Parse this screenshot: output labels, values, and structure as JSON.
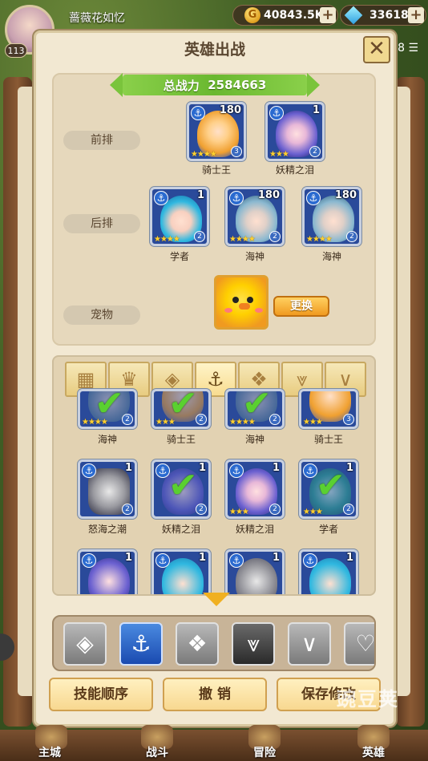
{
  "player": {
    "name": "蔷薇花如忆",
    "level": "113"
  },
  "resources": {
    "gold": "40843.5K",
    "gems": "33618",
    "gold_icon": "gold-coin-icon",
    "gem_icon": "diamond-icon"
  },
  "side_menu": {
    "text": "08"
  },
  "dialog": {
    "title": "英雄出战",
    "close_label": "✕",
    "power_label": "总战力",
    "power_value": "2584663",
    "rows": {
      "front": "前排",
      "back": "后排",
      "pet": "宠物"
    },
    "front": [
      {
        "name": "骑士王",
        "level": "180",
        "badge": "3",
        "stars": "★★★★"
      },
      {
        "name": "妖精之泪",
        "level": "1",
        "badge": "2",
        "stars": "★★★"
      }
    ],
    "back": [
      {
        "name": "学者",
        "level": "1",
        "badge": "2",
        "stars": "★★★★"
      },
      {
        "name": "海神",
        "level": "180",
        "badge": "2",
        "stars": "★★★★"
      },
      {
        "name": "海神",
        "level": "180",
        "badge": "2",
        "stars": "★★★★"
      }
    ],
    "pet_change_label": "更换",
    "pool_row1": [
      {
        "name": "海神",
        "badge": "2",
        "stars": "★★★★"
      },
      {
        "name": "骑士王",
        "badge": "2",
        "stars": "★★★"
      },
      {
        "name": "海神",
        "badge": "2",
        "stars": "★★★★"
      },
      {
        "name": "骑士王",
        "badge": "3",
        "stars": "★★★"
      }
    ],
    "pool_row2": [
      {
        "name": "怒海之潮",
        "level": "1",
        "badge": "2",
        "stars": ""
      },
      {
        "name": "妖精之泪",
        "level": "1",
        "badge": "2",
        "stars": ""
      },
      {
        "name": "妖精之泪",
        "level": "1",
        "badge": "2",
        "stars": "★★★"
      },
      {
        "name": "学者",
        "level": "1",
        "badge": "2",
        "stars": "★★★"
      }
    ],
    "pool_row3": [
      {
        "level": "1"
      },
      {
        "level": "1"
      },
      {
        "level": "1"
      },
      {
        "level": "1"
      }
    ],
    "buttons": {
      "skill_order": "技能顺序",
      "undo": "撤 销",
      "save": "保存修改"
    }
  },
  "bottom_nav": {
    "main_city": "主城",
    "battle": "战斗",
    "adventure": "冒险",
    "hero": "英雄"
  },
  "watermark": "豌豆荚"
}
